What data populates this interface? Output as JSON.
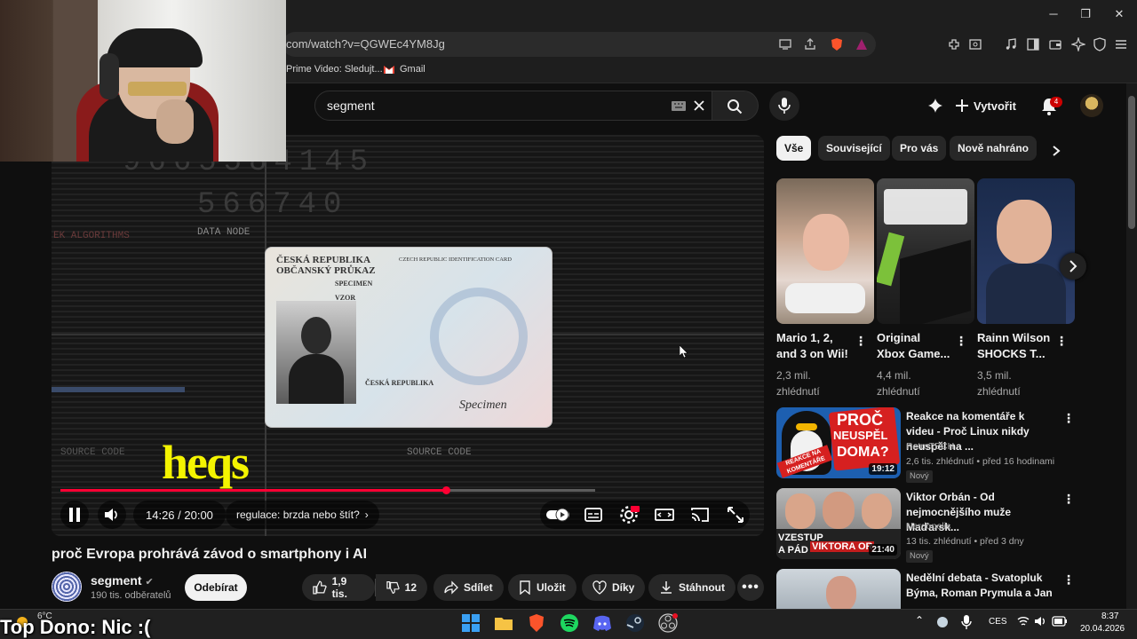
{
  "browser": {
    "url": "com/watch?v=QGWEc4YM8Jg",
    "bookmarks": [
      "Prime Video: Sledujt...",
      "Gmail"
    ]
  },
  "header": {
    "search_value": "segment",
    "create_label": "Vytvořit",
    "notification_count": "4"
  },
  "player": {
    "card_title1": "ČESKÁ REPUBLIKA",
    "card_title2": "OBČANSKÝ PRŮKAZ",
    "card_title3": "CZECH REPUBLIC IDENTIFICATION CARD",
    "card_specimen": "SPECIMEN",
    "card_vzor": "VZOR",
    "card_country": "ČESKÁ REPUBLIKA",
    "bg_data_node": "DATA NODE",
    "bg_source_code": "SOURCE CODE",
    "bg_numbers1": "9665584145",
    "bg_numbers2": "566740",
    "bg_algorithms": "EK ALGORITHMS",
    "caption": "heqs",
    "time": "14:26 / 20:00",
    "chapter": "regulace: brzda nebo štít?",
    "progress_fraction": 0.7217
  },
  "video": {
    "title": "proč Evropa prohrává závod o smartphony i AI",
    "channel": "segment",
    "subscribers": "190 tis. odběratelů",
    "subscribe_label": "Odebírat",
    "likes": "1,9 tis.",
    "dislikes": "12",
    "share_label": "Sdílet",
    "save_label": "Uložit",
    "thanks_label": "Díky",
    "download_label": "Stáhnout"
  },
  "chips": [
    "Vše",
    "Související",
    "Pro vás",
    "Nově nahráno"
  ],
  "shorts": [
    {
      "title": "Mario 1, 2, and 3 on Wii!",
      "views": "2,3 mil. zhlédnutí"
    },
    {
      "title": "Original Xbox Game...",
      "views": "4,4 mil. zhlédnutí"
    },
    {
      "title": "Rainn Wilson SHOCKS T...",
      "views": "3,5 mil. zhlédnutí"
    }
  ],
  "recommendations": [
    {
      "title": "Reakce na komentáře k videu - Proč Linux nikdy neuspěl na ...",
      "channel": "RetroTECH",
      "meta": "2,6 tis. zhlédnutí • před 16 hodinami",
      "badge": "Nový",
      "duration": "19:12",
      "thumb_text1": "PROČ",
      "thumb_text2": "NEUSPĚL",
      "thumb_text3": "DOMA?",
      "thumb_tag": "REAKCE NA KOMENTÁŘE"
    },
    {
      "title": "Viktor Orbán - Od nejmocnějšího muže Maďarsk...",
      "channel": "Nerdopolis",
      "meta": "13 tis. zhlédnutí • před 3 dny",
      "badge": "Nový",
      "duration": "21:40",
      "thumb_text1": "VZESTUP",
      "thumb_text2": "A PÁD",
      "thumb_text3": "VIKTORA OR"
    },
    {
      "title": "Nedělní debata - Svatopluk Býma, Roman Prymula a Jan ..."
    }
  ],
  "taskbar": {
    "weather": "6°C",
    "overlay_text": "Top Dono: Nic :(",
    "lang": "CES",
    "time": "8:37",
    "date": "20.04.2026"
  },
  "colors": {
    "accent": "#ff0033",
    "caption": "#f4f400"
  }
}
